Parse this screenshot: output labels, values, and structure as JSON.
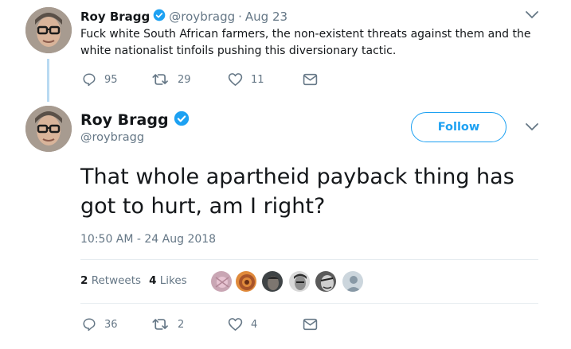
{
  "parent_tweet": {
    "display_name": "Roy Bragg",
    "handle": "@roybragg",
    "separator": "·",
    "date": "Aug 23",
    "text_line1": "Fuck white South African farmers, the non-existent threats against them and the",
    "text_line2": "white nationalist tinfoils pushing this diversionary tactic.",
    "replies": "95",
    "retweets": "29",
    "likes": "11"
  },
  "main_tweet": {
    "display_name": "Roy Bragg",
    "handle": "@roybragg",
    "follow_label": "Follow",
    "text_line1": "That whole apartheid payback thing has",
    "text_line2": "got to hurt, am I right?",
    "timestamp": "10:50 AM - 24 Aug 2018",
    "retweet_count": "2",
    "retweet_label": "Retweets",
    "like_count": "4",
    "like_label": "Likes",
    "replies": "36",
    "retweets": "2",
    "likes": "4"
  },
  "icons": {
    "verified": "verified-badge-icon",
    "reply": "reply-icon",
    "retweet": "retweet-icon",
    "like": "heart-icon",
    "dm": "envelope-icon",
    "more": "chevron-down-icon"
  },
  "colors": {
    "accent": "#1da1f2",
    "muted": "#657786",
    "thread_line": "#b9daf2",
    "divider": "#e6ecf0"
  }
}
